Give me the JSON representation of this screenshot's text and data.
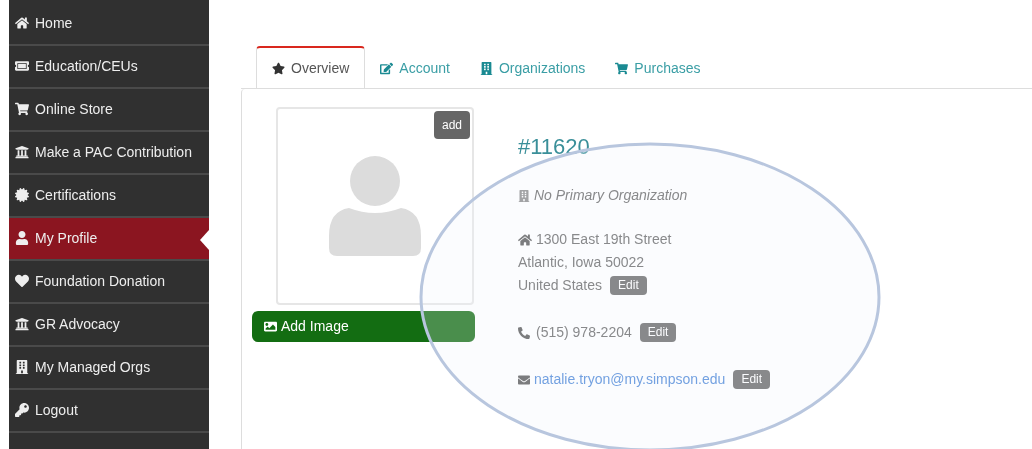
{
  "sidebar": {
    "items": [
      {
        "label": "Home",
        "selected": false
      },
      {
        "label": "Education/CEUs",
        "selected": false
      },
      {
        "label": "Online Store",
        "selected": false
      },
      {
        "label": "Make a PAC Contribution",
        "selected": false
      },
      {
        "label": "Certifications",
        "selected": false
      },
      {
        "label": "My Profile",
        "selected": true
      },
      {
        "label": "Foundation Donation",
        "selected": false
      },
      {
        "label": "GR Advocacy",
        "selected": false
      },
      {
        "label": "My Managed Orgs",
        "selected": false
      },
      {
        "label": "Logout",
        "selected": false
      }
    ]
  },
  "tabs": [
    {
      "label": "Overview",
      "selected": true
    },
    {
      "label": "Account",
      "selected": false
    },
    {
      "label": "Organizations",
      "selected": false
    },
    {
      "label": "Purchases",
      "selected": false
    }
  ],
  "profile": {
    "add_badge": "add",
    "add_image_button": "Add Image",
    "member_id": "#11620",
    "organization": "No Primary Organization",
    "address_lines": [
      "1300 East 19th Street",
      "Atlantic, Iowa 50022",
      "United States"
    ],
    "address_edit": "Edit",
    "phone": "(515) 978-2204",
    "phone_edit": "Edit",
    "email": "natalie.tryon@my.simpson.edu",
    "email_edit": "Edit"
  }
}
